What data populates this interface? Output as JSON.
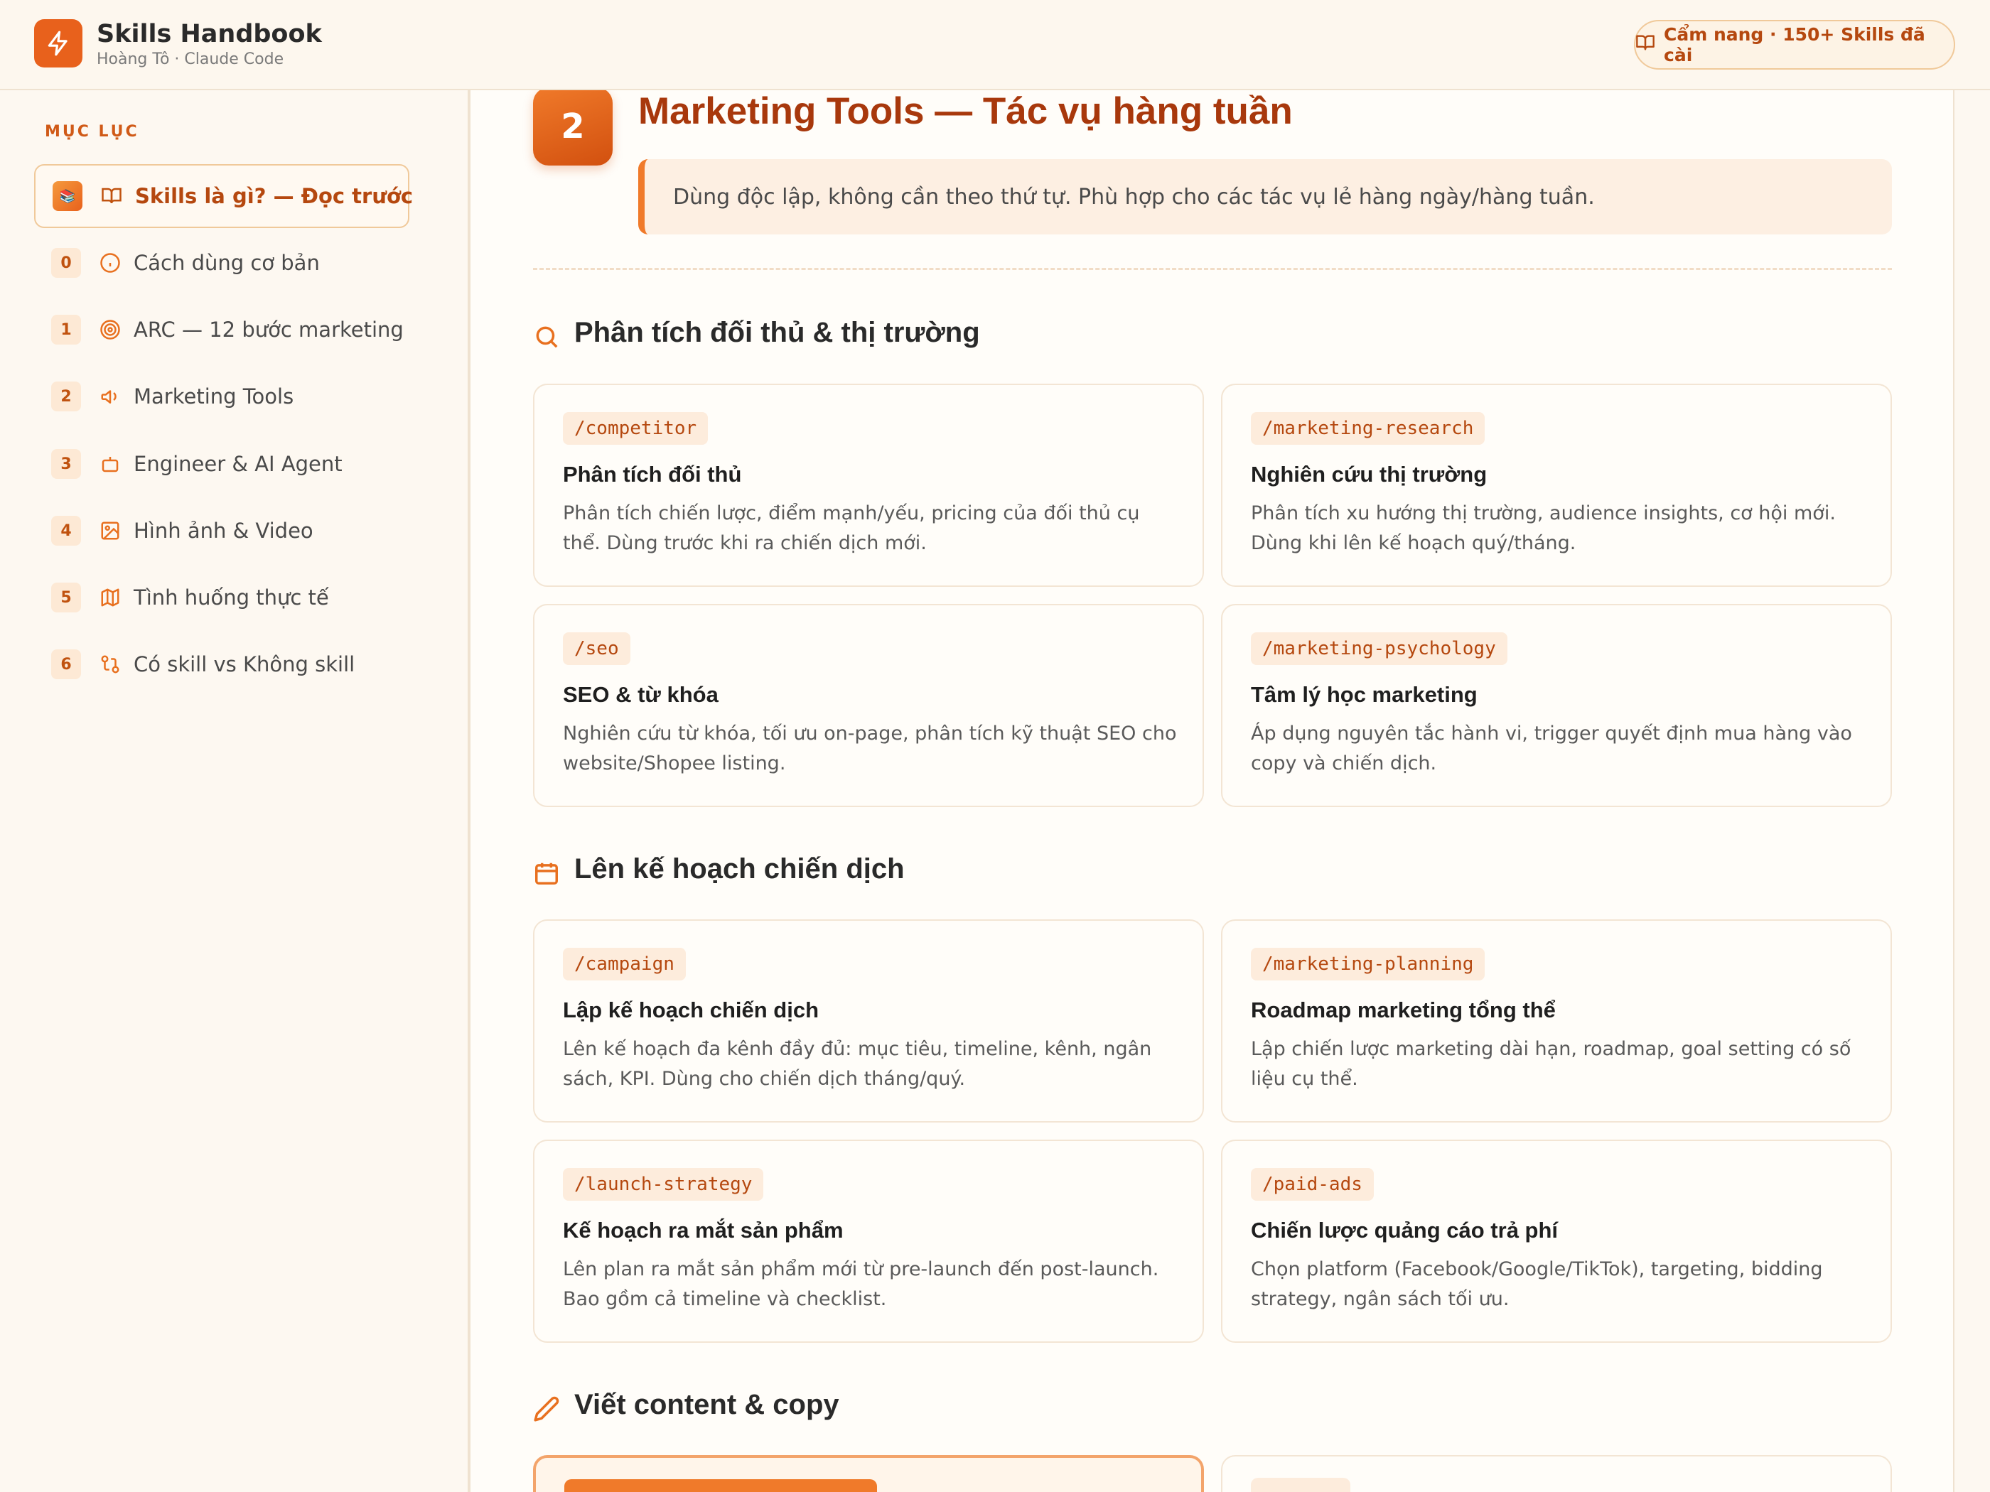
{
  "app": {
    "title": "Skills Handbook",
    "subtitle": "Hoàng Tô · Claude Code",
    "badge": "Cẩm nang · 150+ Skills đã cài"
  },
  "sidebar": {
    "heading": "MỤC LỤC",
    "items": [
      {
        "num": "📚",
        "icon": "book-open-icon",
        "label": "Skills là gì? — Đọc trước",
        "active": true
      },
      {
        "num": "0",
        "icon": "info-icon",
        "label": "Cách dùng cơ bản"
      },
      {
        "num": "1",
        "icon": "target-icon",
        "label": "ARC — 12 bước marketing"
      },
      {
        "num": "2",
        "icon": "megaphone-icon",
        "label": "Marketing Tools"
      },
      {
        "num": "3",
        "icon": "bot-icon",
        "label": "Engineer & AI Agent"
      },
      {
        "num": "4",
        "icon": "image-icon",
        "label": "Hình ảnh & Video"
      },
      {
        "num": "5",
        "icon": "map-icon",
        "label": "Tình huống thực tế"
      },
      {
        "num": "6",
        "icon": "git-compare-icon",
        "label": "Có skill vs Không skill"
      }
    ]
  },
  "section": {
    "number": "2",
    "title": "Marketing Tools — Tác vụ hàng tuần",
    "note": "Dùng độc lập, không cần theo thứ tự. Phù hợp cho các tác vụ lẻ hàng ngày/hàng tuần."
  },
  "groups": [
    {
      "title": "Phân tích đối thủ & thị trường",
      "icon": "search-icon",
      "cards": [
        {
          "cmd": "/competitor",
          "title": "Phân tích đối thủ",
          "desc": "Phân tích chiến lược, điểm mạnh/yếu, pricing của đối thủ cụ thể. Dùng trước khi ra chiến dịch mới."
        },
        {
          "cmd": "/marketing-research",
          "title": "Nghiên cứu thị trường",
          "desc": "Phân tích xu hướng thị trường, audience insights, cơ hội mới. Dùng khi lên kế hoạch quý/tháng."
        },
        {
          "cmd": "/seo",
          "title": "SEO & từ khóa",
          "desc": "Nghiên cứu từ khóa, tối ưu on-page, phân tích kỹ thuật SEO cho website/Shopee listing."
        },
        {
          "cmd": "/marketing-psychology",
          "title": "Tâm lý học marketing",
          "desc": "Áp dụng nguyên tắc hành vi, trigger quyết định mua hàng vào copy và chiến dịch."
        }
      ]
    },
    {
      "title": "Lên kế hoạch chiến dịch",
      "icon": "calendar-icon",
      "cards": [
        {
          "cmd": "/campaign",
          "title": "Lập kế hoạch chiến dịch",
          "desc": "Lên kế hoạch đa kênh đầy đủ: mục tiêu, timeline, kênh, ngân sách, KPI. Dùng cho chiến dịch tháng/quý."
        },
        {
          "cmd": "/marketing-planning",
          "title": "Roadmap marketing tổng thể",
          "desc": "Lập chiến lược marketing dài hạn, roadmap, goal setting có số liệu cụ thể."
        },
        {
          "cmd": "/launch-strategy",
          "title": "Kế hoạch ra mắt sản phẩm",
          "desc": "Lên plan ra mắt sản phẩm mới từ pre-launch đến post-launch. Bao gồm cả timeline và checklist."
        },
        {
          "cmd": "/paid-ads",
          "title": "Chiến lược quảng cáo trả phí",
          "desc": "Chọn platform (Facebook/Google/TikTok), targeting, bidding strategy, ngân sách tối ưu."
        }
      ]
    },
    {
      "title": "Viết content & copy",
      "icon": "pencil-icon"
    }
  ]
}
